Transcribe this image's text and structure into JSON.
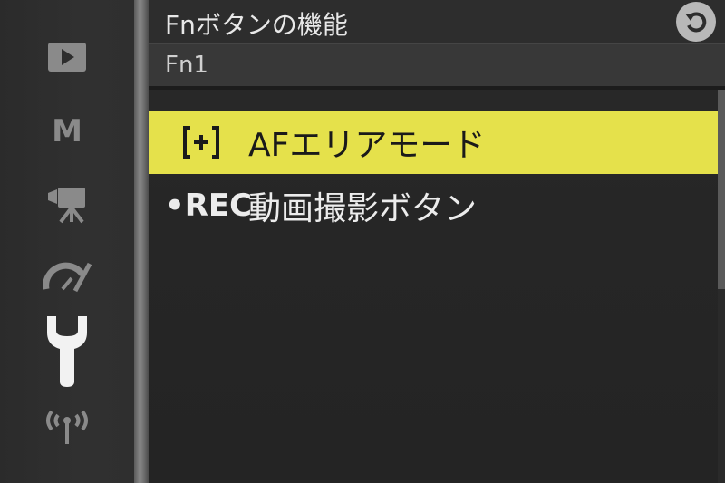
{
  "header": {
    "title": "Fnボタンの機能",
    "subtitle": "Fn1"
  },
  "sidebar": {
    "items": [
      {
        "name": "playback",
        "icon": "play-icon",
        "active": false
      },
      {
        "name": "photo-shooting",
        "icon": "M",
        "active": false
      },
      {
        "name": "movie",
        "icon": "movie-camera-icon",
        "active": false
      },
      {
        "name": "custom-settings",
        "icon": "gauge-pencil-icon",
        "active": false
      },
      {
        "name": "setup",
        "icon": "wrench-icon",
        "active": true
      },
      {
        "name": "network",
        "icon": "wireless-icon",
        "active": false
      }
    ]
  },
  "menu": {
    "items": [
      {
        "icon_text": "[+]",
        "label": "AFエリアモード",
        "selected": true
      },
      {
        "icon_text": "•REC",
        "label": "動画撮影ボタン",
        "selected": false
      }
    ]
  },
  "colors": {
    "highlight": "#e5e14b",
    "text": "#ececec",
    "background": "#262626",
    "sidebar_icon": "#8a8a8a",
    "active_icon": "#f2f2f2"
  }
}
